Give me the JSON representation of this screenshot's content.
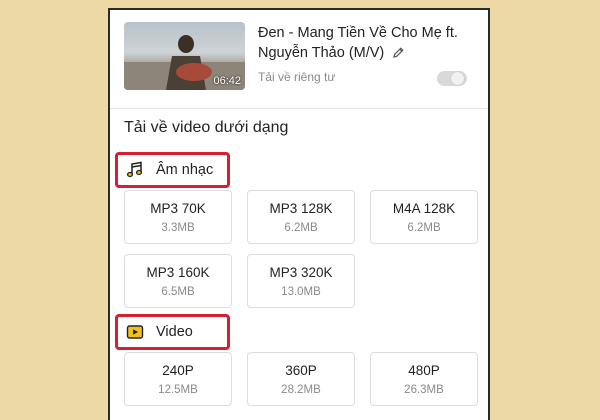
{
  "video": {
    "title": "Đen - Mang Tiền Về Cho Mẹ ft. Nguyễn Thảo (M/V)",
    "duration": "06:42",
    "private_label": "Tải về riêng tư",
    "private_enabled": false
  },
  "download_heading": "Tải về video dưới dạng",
  "sections": {
    "music": {
      "label": "Âm nhạc",
      "icon": "music-note-icon",
      "options": [
        {
          "format": "MP3 70K",
          "size": "3.3MB"
        },
        {
          "format": "MP3 128K",
          "size": "6.2MB"
        },
        {
          "format": "M4A 128K",
          "size": "6.2MB"
        },
        {
          "format": "MP3 160K",
          "size": "6.5MB"
        },
        {
          "format": "MP3 320K",
          "size": "13.0MB"
        }
      ]
    },
    "video": {
      "label": "Video",
      "icon": "video-play-icon",
      "options": [
        {
          "format": "240P",
          "size": "12.5MB"
        },
        {
          "format": "360P",
          "size": "28.2MB"
        },
        {
          "format": "480P",
          "size": "26.3MB"
        }
      ]
    }
  },
  "colors": {
    "background": "#ecd9a6",
    "highlight": "#d62031",
    "icon_accent": "#f2c21b"
  }
}
